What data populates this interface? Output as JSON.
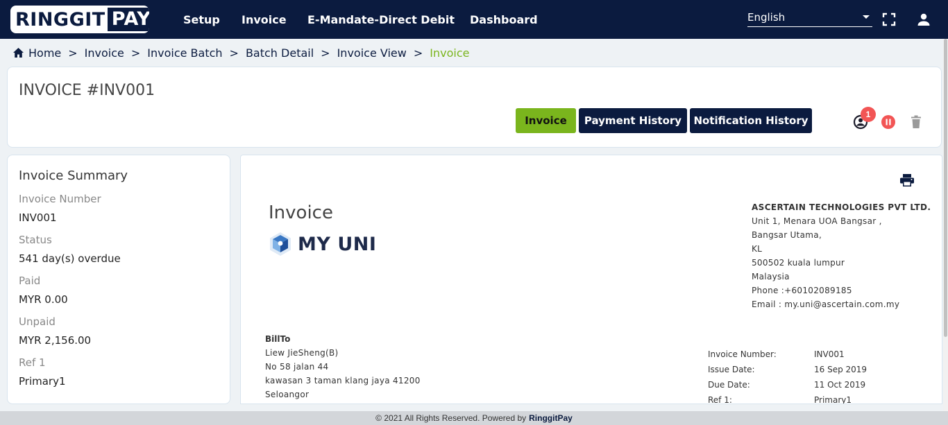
{
  "logo": {
    "part1": "RINGGIT",
    "part2": "PAY"
  },
  "nav": {
    "items": [
      {
        "label": "Setup"
      },
      {
        "label": "Invoice"
      },
      {
        "label": "E-Mandate-Direct Debit"
      },
      {
        "label": "Dashboard"
      }
    ],
    "language": "English"
  },
  "breadcrumb": {
    "items": [
      "Home",
      "Invoice",
      "Invoice Batch",
      "Batch Detail",
      "Invoice View",
      "Invoice"
    ]
  },
  "header": {
    "title": "INVOICE #INV001",
    "tabs": [
      "Invoice",
      "Payment History",
      "Notification History"
    ],
    "badge_count": "1"
  },
  "summary": {
    "title": "Invoice Summary",
    "fields": [
      {
        "label": "Invoice Number",
        "value": "INV001"
      },
      {
        "label": "Status",
        "value": "541 day(s) overdue"
      },
      {
        "label": "Paid",
        "value": "MYR 0.00"
      },
      {
        "label": "Unpaid",
        "value": "MYR 2,156.00"
      },
      {
        "label": "Ref 1",
        "value": "Primary1"
      }
    ]
  },
  "document": {
    "title": "Invoice",
    "brand": "MY UNI",
    "company": {
      "name": "ASCERTAIN TECHNOLOGIES PVT LTD.",
      "lines": [
        "Unit 1, Menara UOA Bangsar ,",
        "Bangsar Utama,",
        "KL",
        "500502 kuala lumpur",
        "Malaysia",
        "Phone :+60102089185",
        "Email : my.uni@ascertain.com.my"
      ]
    },
    "bill_to": {
      "title": "BillTo",
      "lines": [
        "Liew JieSheng(B)",
        "No 58 jalan 44",
        "kawasan 3 taman klang jaya 41200",
        "Seloangor"
      ]
    },
    "meta": [
      {
        "key": "Invoice Number:",
        "value": "INV001"
      },
      {
        "key": "Issue Date:",
        "value": "16 Sep 2019"
      },
      {
        "key": "Due Date:",
        "value": "11 Oct 2019"
      },
      {
        "key": "Ref 1:",
        "value": "Primary1"
      }
    ]
  },
  "footer": {
    "text": "© 2021 All Rights Reserved. Powered by",
    "brand": "RinggitPay"
  },
  "colors": {
    "navy": "#0b1b3f",
    "green": "#7ab51d",
    "badge_red": "#f25555"
  }
}
